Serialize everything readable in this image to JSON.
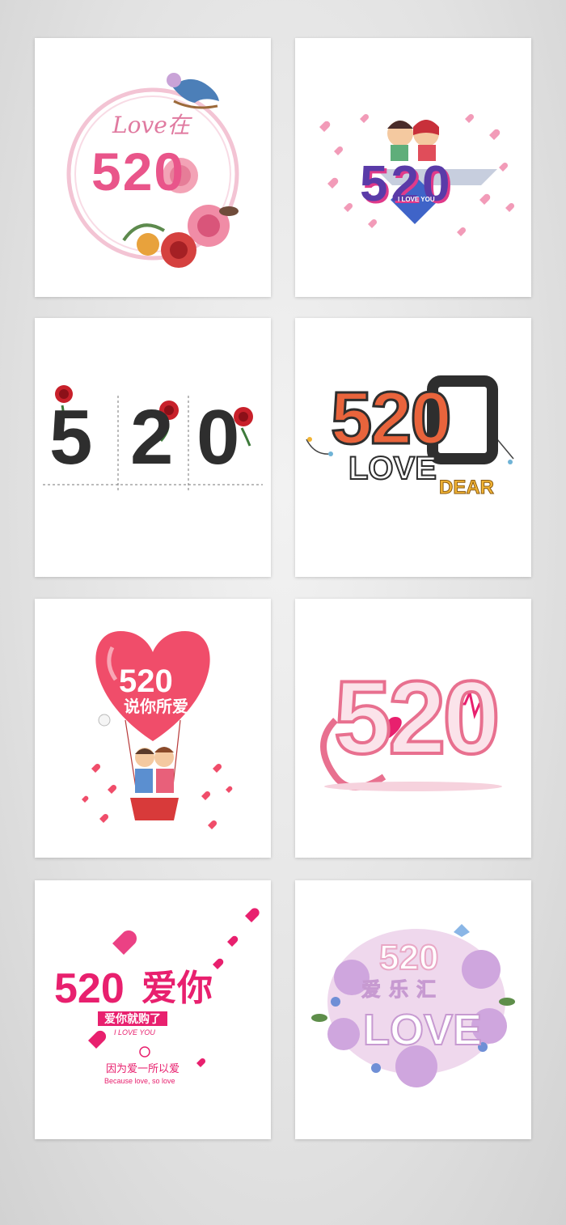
{
  "colors": {
    "pink": "#e9558a",
    "hot_pink": "#e8206e",
    "rose_red": "#c8202a",
    "dark": "#2e2e2e",
    "orange": "#e9643c",
    "mustard": "#f2b434",
    "light_pink": "#f6b5ca"
  },
  "tiles": [
    {
      "label": "Love在",
      "number": "520"
    },
    {
      "number": "520",
      "banner": "I LOVE YOU"
    },
    {
      "digits": [
        "5",
        "2",
        "0"
      ]
    },
    {
      "number": "520",
      "line1": "LOVE",
      "line2": "DEAR"
    },
    {
      "number": "520",
      "line1": "说你所爱"
    },
    {
      "number": "520"
    },
    {
      "number": "520",
      "word": "爱你",
      "sub": "爱你就购了",
      "en": "I LOVE YOU",
      "line1": "因为爱一所以爱",
      "line2": "Because love, so love"
    },
    {
      "number": "520",
      "line1": "爱乐汇",
      "word": "LOVE"
    }
  ]
}
